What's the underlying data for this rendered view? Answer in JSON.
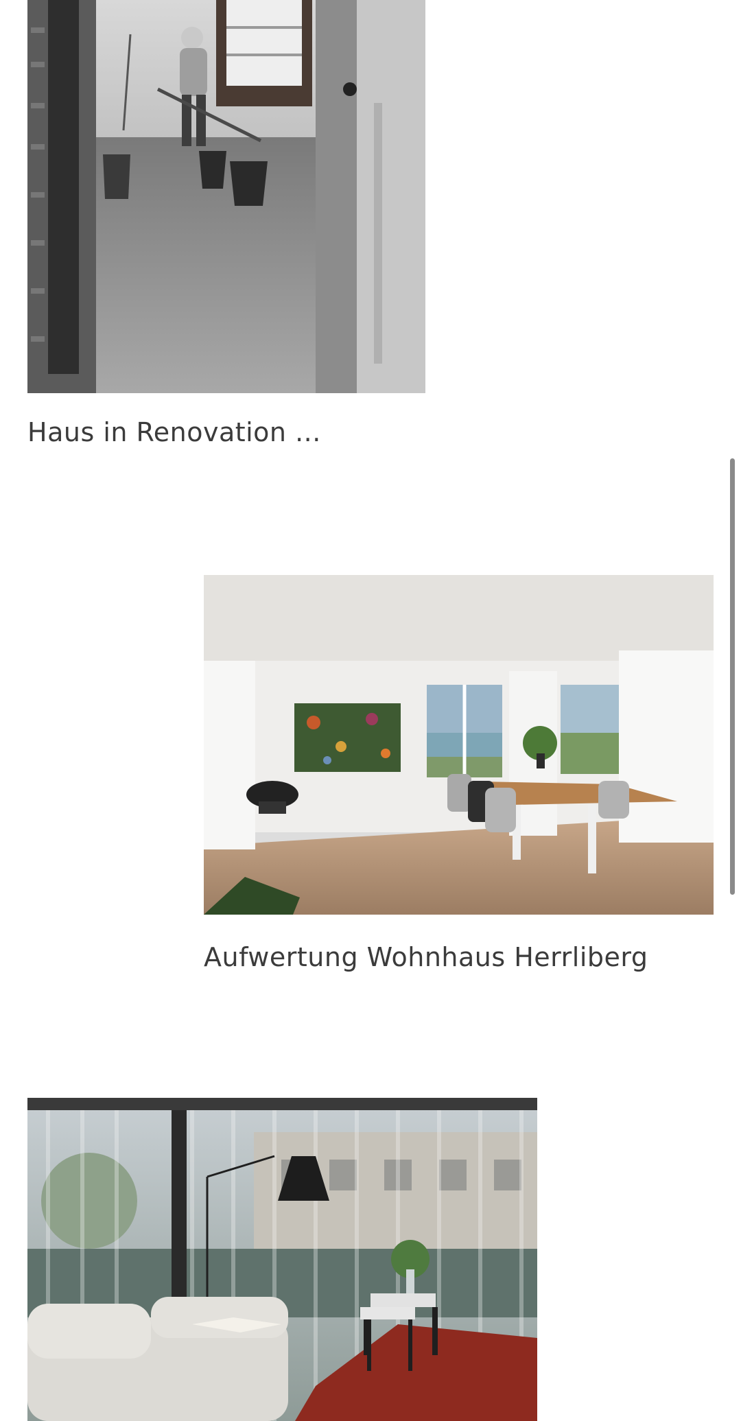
{
  "projects": [
    {
      "title": "Haus in Renovation ...",
      "image": "black-and-white photo: worker shoveling debris in a gutted room with buckets and an open window"
    },
    {
      "title": "Aufwertung Wohnhaus Herrliberg",
      "image": "bright dining room with long wooden table, chairs, colorful painting and lake view through windows"
    },
    {
      "title": "",
      "image": "living room with white sofa, floor lamp, side tables on red rug, sheer curtains"
    }
  ],
  "colors": {
    "text": "#3b3b3b",
    "background": "#ffffff",
    "scrollbar": "#8a8a8a"
  }
}
